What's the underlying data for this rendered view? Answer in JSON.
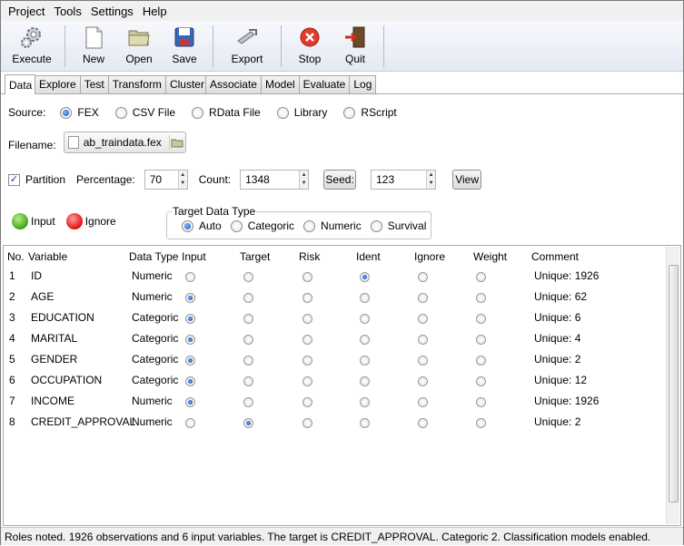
{
  "menu": [
    {
      "label": "Project"
    },
    {
      "label": "Tools"
    },
    {
      "label": "Settings"
    },
    {
      "label": "Help"
    }
  ],
  "toolbar": {
    "execute": "Execute",
    "new": "New",
    "open": "Open",
    "save": "Save",
    "export": "Export",
    "stop": "Stop",
    "quit": "Quit"
  },
  "tabs": [
    "Data",
    "Explore",
    "Test",
    "Transform",
    "Cluster",
    "Associate",
    "Model",
    "Evaluate",
    "Log"
  ],
  "source": {
    "label": "Source:",
    "options": [
      "FEX",
      "CSV File",
      "RData File",
      "Library",
      "RScript"
    ],
    "selected": "FEX"
  },
  "filename": {
    "label": "Filename:",
    "value": "ab_traindata.fex"
  },
  "partition": {
    "label": "Partition",
    "checked": true,
    "percentage_label": "Percentage:",
    "percentage": "70",
    "count_label": "Count:",
    "count": "1348",
    "seed_button": "Seed:",
    "seed": "123",
    "view_button": "View"
  },
  "legend_input": "Input",
  "legend_ignore": "Ignore",
  "target_type": {
    "title": "Target Data Type",
    "options": [
      "Auto",
      "Categoric",
      "Numeric",
      "Survival"
    ],
    "selected": "Auto"
  },
  "columns": [
    "No.",
    "Variable",
    "Data Type",
    "Input",
    "Target",
    "Risk",
    "Ident",
    "Ignore",
    "Weight",
    "Comment"
  ],
  "rows": [
    {
      "no": "1",
      "variable": "ID",
      "type": "Numeric",
      "role": "Ident",
      "comment": "Unique: 1926"
    },
    {
      "no": "2",
      "variable": "AGE",
      "type": "Numeric",
      "role": "Input",
      "comment": "Unique: 62"
    },
    {
      "no": "3",
      "variable": "EDUCATION",
      "type": "Categoric",
      "role": "Input",
      "comment": "Unique: 6"
    },
    {
      "no": "4",
      "variable": "MARITAL",
      "type": "Categoric",
      "role": "Input",
      "comment": "Unique: 4"
    },
    {
      "no": "5",
      "variable": "GENDER",
      "type": "Categoric",
      "role": "Input",
      "comment": "Unique: 2"
    },
    {
      "no": "6",
      "variable": "OCCUPATION",
      "type": "Categoric",
      "role": "Input",
      "comment": "Unique: 12"
    },
    {
      "no": "7",
      "variable": "INCOME",
      "type": "Numeric",
      "role": "Input",
      "comment": "Unique: 1926"
    },
    {
      "no": "8",
      "variable": "CREDIT_APPROVAL",
      "type": "Numeric",
      "role": "Target",
      "comment": "Unique: 2"
    }
  ],
  "status": "Roles noted. 1926 observations and 6 input variables. The target is CREDIT_APPROVAL. Categoric 2. Classification models enabled."
}
